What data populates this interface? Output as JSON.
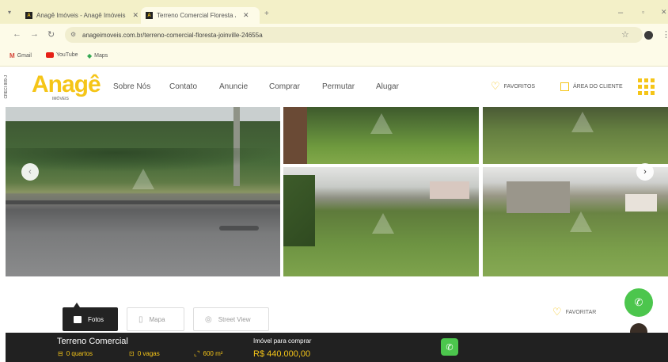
{
  "browser": {
    "tabs": [
      {
        "title": "Anagê Imóveis - Anagê Imóveis",
        "active": false
      },
      {
        "title": "Terreno Comercial Floresta Joinville",
        "active": true
      }
    ],
    "favicon_letter": "A",
    "url": "anageimoveis.com.br/terreno-comercial-floresta-joinville-24655a",
    "bookmarks": [
      "Gmail",
      "YouTube",
      "Maps"
    ]
  },
  "site": {
    "logo": "Anagê",
    "logo_sub": "IMÓVEIS",
    "creci": "CRECI 809-J",
    "nav": [
      "Sobre Nós",
      "Contato",
      "Anuncie",
      "Comprar",
      "Permutar",
      "Alugar"
    ],
    "favorites": "FAVORITOS",
    "client_area": "ÁREA DO CLIENTE"
  },
  "view_buttons": {
    "photos": "Fotos",
    "map": "Mapa",
    "street_view": "Street View"
  },
  "favoritar": "FAVORITAR",
  "property": {
    "title": "Terreno Comercial",
    "bedrooms": "0 quartos",
    "parking": "0 vagas",
    "area": "600 m²",
    "for_sale_label": "Imóvel para comprar",
    "price": "R$ 440.000,00"
  },
  "colors": {
    "accent_yellow": "#f5c518",
    "whatsapp_green": "#4cc64d",
    "bottom_bar": "#212121"
  }
}
